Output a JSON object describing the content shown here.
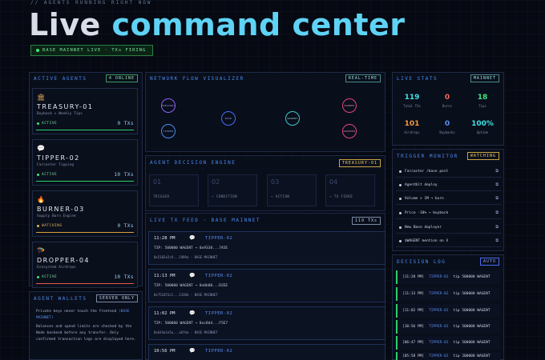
{
  "header": {
    "eyebrow": "// AGENTS RUNNING RIGHT NOW",
    "title_white": "Live",
    "title_cyan": "command center",
    "status_pill": "BASE MAINNET LIVE · TXs FIRING"
  },
  "agents_panel": {
    "title": "ACTIVE AGENTS",
    "badge": "4 ONLINE",
    "agents": [
      {
        "icon": "treasury-icon",
        "glyph": "🏛",
        "name": "TREASURY-01",
        "desc": "Buyback + Weekly Tips",
        "status": "ACTIVE",
        "txs": "0 TXs"
      },
      {
        "icon": "chat-icon",
        "glyph": "💬",
        "name": "TIPPER-02",
        "desc": "Farcaster Tipping",
        "status": "ACTIVE",
        "txs": "10 TXs"
      },
      {
        "icon": "fire-icon",
        "glyph": "🔥",
        "name": "BURNER-03",
        "desc": "Supply Burn Engine",
        "status": "WATCHING",
        "txs": "0 TXs"
      },
      {
        "icon": "parachute-icon",
        "glyph": "🪂",
        "name": "DROPPER-04",
        "desc": "Ecosystem Airdrops",
        "status": "ACTIVE",
        "txs": "10 TXs"
      }
    ]
  },
  "wallets_panel": {
    "title": "AGENT WALLETS",
    "badge": "SERVER ONLY",
    "line1": "Private keys never touch the frontend",
    "line1_link": "(BASE MAINNET)",
    "line2": "Balances and spend limits are checked by the Node backend before any transfer. Only confirmed transaction logs are displayed here."
  },
  "network_panel": {
    "title": "NETWORK FLOW VISUALIZER",
    "badge": "REAL-TIME",
    "nodes": [
      "TREASURY",
      "TIPPER",
      "BASE",
      "WAGENT",
      "BURNER",
      "DROPPER"
    ]
  },
  "decision_panel": {
    "title": "AGENT DECISION ENGINE",
    "badge": "TREASURY-01",
    "steps": [
      {
        "num": "01",
        "label": "TRIGGER"
      },
      {
        "num": "02",
        "label": "→ CONDITION"
      },
      {
        "num": "03",
        "label": "→ ACTION"
      },
      {
        "num": "04",
        "label": "→ TX FIRED"
      }
    ]
  },
  "feed_panel": {
    "title": "LIVE TX FEED · BASE MAINNET",
    "badge": "119 TXs",
    "items": [
      {
        "time": "11:28 PM",
        "who": "TIPPER-02",
        "msg": "TIP: 500000 WAGENT → 0x9338...7A5E",
        "hash": "0x5102e2c9...1989a · BASE MAINNET"
      },
      {
        "time": "11:13 PM",
        "who": "TIPPER-02",
        "msg": "TIP: 500000 WAGENT → 0x0b08...D2EE",
        "hash": "0x752d51c1...1336b · BASE MAINNET"
      },
      {
        "time": "11:02 PM",
        "who": "TIPPER-02",
        "msg": "TIP: 500000 WAGENT → 0xc8d4...F5E7",
        "hash": "0x644a1e5a...a6fda · BASE MAINNET"
      },
      {
        "time": "10:56 PM",
        "who": "TIPPER-02",
        "msg": "",
        "hash": ""
      }
    ]
  },
  "stats_panel": {
    "title": "LIVE STATS",
    "badge": "MAINNET",
    "stats": [
      {
        "value": "119",
        "label": "Total TXs",
        "color": "#3ee0e0"
      },
      {
        "value": "0",
        "label": "Burns",
        "color": "#f06a5a"
      },
      {
        "value": "18",
        "label": "Tips",
        "color": "#3ee67a"
      },
      {
        "value": "101",
        "label": "Airdrops",
        "color": "#f5973e"
      },
      {
        "value": "0",
        "label": "Buybacks",
        "color": "#5b8df0"
      },
      {
        "value": "100%",
        "label": "Uptime",
        "color": "#3ee0e0"
      }
    ]
  },
  "trigger_panel": {
    "title": "TRIGGER MONITOR",
    "badge": "WATCHING",
    "items": [
      "Farcaster /base post",
      "AgentKit deploy",
      "Volume > 1M → burn",
      "Price -10% → buyback",
      "New Base deployer",
      "$WAGENT mention on X"
    ]
  },
  "log_panel": {
    "title": "DECISION LOG",
    "badge": "AUTO",
    "items": [
      {
        "time": "[11:28 PM]",
        "who": "TIPPER-02",
        "msg": "tip 500000 WAGENT"
      },
      {
        "time": "[11:13 PM]",
        "who": "TIPPER-02",
        "msg": "tip 500000 WAGENT"
      },
      {
        "time": "[11:02 PM]",
        "who": "TIPPER-02",
        "msg": "tip 500000 WAGENT"
      },
      {
        "time": "[10:56 PM]",
        "who": "TIPPER-02",
        "msg": "tip 500000 WAGENT"
      },
      {
        "time": "[06:47 PM]",
        "who": "TIPPER-02",
        "msg": "tip 500000 WAGENT"
      },
      {
        "time": "[05:58 PM]",
        "who": "TIPPER-02",
        "msg": "tip 200000 WAGENT"
      }
    ]
  }
}
